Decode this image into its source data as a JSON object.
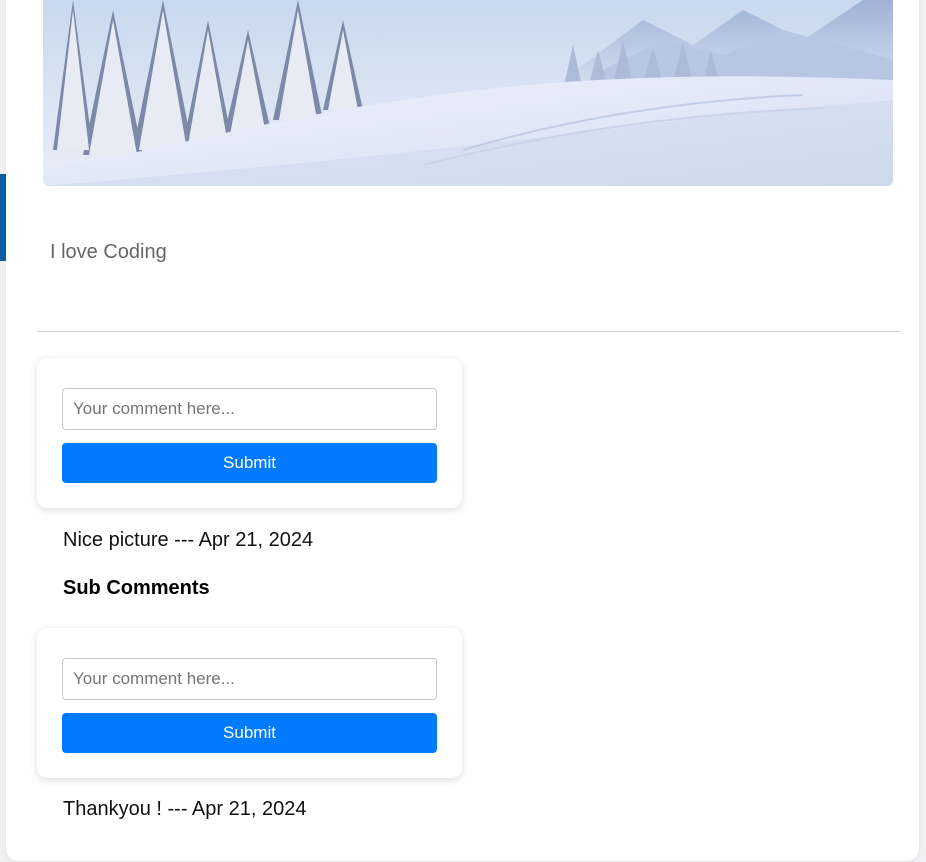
{
  "post": {
    "image_icon": "snowy-forest-landscape",
    "text": "I love Coding"
  },
  "comment_form": {
    "placeholder": "Your comment here...",
    "submit_label": "Submit"
  },
  "comments": [
    {
      "text": "Nice picture",
      "separator": "---",
      "date": "Apr 21, 2024",
      "display": "Nice picture --- Apr 21, 2024"
    }
  ],
  "sub_comments": {
    "heading": "Sub Comments",
    "form": {
      "placeholder": "Your comment here...",
      "submit_label": "Submit"
    },
    "items": [
      {
        "text": "Thankyou !",
        "separator": "---",
        "date": "Apr 21, 2024",
        "display": "Thankyou ! --- Apr 21, 2024"
      }
    ]
  },
  "colors": {
    "accent": "#0a5fa3",
    "button": "#007bff",
    "post_text": "#666666",
    "divider": "#cfcfcf"
  }
}
